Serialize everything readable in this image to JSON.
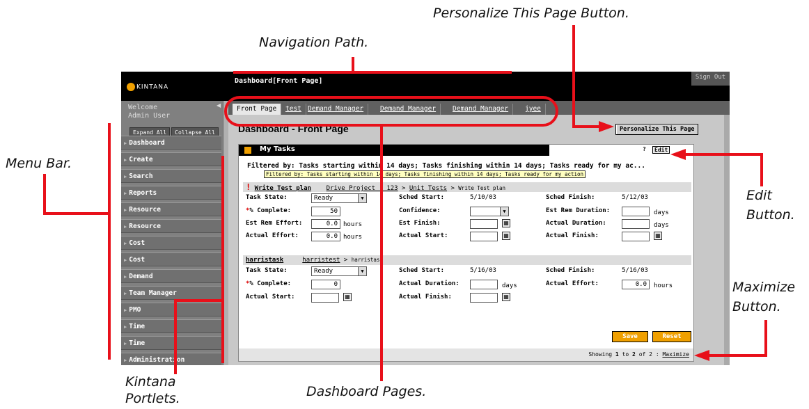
{
  "callouts": {
    "personalize": "Personalize This Page Button.",
    "navigation": "Navigation Path.",
    "menu_bar": "Menu Bar.",
    "edit_1": "Edit",
    "edit_2": "Button.",
    "maximize_1": "Maximize",
    "maximize_2": "Button.",
    "portlets_1": "Kintana",
    "portlets_2": "Portlets.",
    "dashboard_pages": "Dashboard Pages."
  },
  "app": {
    "logo": "KINTANA",
    "nav_path": "Dashboard[Front Page]",
    "sign_out": "Sign Out"
  },
  "sidebar": {
    "welcome_1": "Welcome",
    "welcome_2": "Admin User",
    "expand_all": "Expand All",
    "collapse_all": "Collapse All",
    "items": [
      "Dashboard",
      "Create",
      "Search",
      "Reports",
      "Resource",
      "Resource",
      "Cost",
      "Cost",
      "Demand",
      "Team Manager",
      "PMO",
      "Time",
      "Time",
      "Administration"
    ]
  },
  "tabs": [
    "Front Page",
    "test",
    "Demand Manager",
    "Demand Manager",
    "Demand Manager",
    "jyee"
  ],
  "page": {
    "title": "Dashboard - Front Page",
    "personalize_button": "Personalize This Page"
  },
  "portlet": {
    "title": "My Tasks",
    "help": "?",
    "edit": "Edit",
    "filter": "Filtered by: Tasks starting within 14 days; Tasks finishing within 14 days; Tasks ready for my ac...",
    "tooltip": "Filtered by: Tasks starting within 14 days; Tasks finishing within 14 days; Tasks ready for my action",
    "task1": {
      "bang": "!",
      "name": "Write Test plan",
      "project": "Drive Project - 123",
      "sep1": ">",
      "unit": "Unit Tests",
      "sep2": ">",
      "leaf": "Write Test plan",
      "state_label": "Task State:",
      "state_value": "Ready",
      "sched_start_label": "Sched Start:",
      "sched_start": "5/10/03",
      "sched_finish_label": "Sched Finish:",
      "sched_finish": "5/12/03",
      "pct_label": "% Complete:",
      "pct_value": "50",
      "confidence_label": "Confidence:",
      "est_rem_dur_label": "Est Rem Duration:",
      "days": "days",
      "est_rem_effort_label": "Est Rem Effort:",
      "est_rem_effort": "0.0",
      "hours": "hours",
      "est_finish_label": "Est Finish:",
      "actual_duration_label": "Actual Duration:",
      "actual_effort_label": "Actual Effort:",
      "actual_effort": "0.0",
      "actual_start_label": "Actual Start:",
      "actual_finish_label": "Actual Finish:"
    },
    "task2": {
      "name": "harristask",
      "project": "harristest",
      "sep": ">",
      "leaf": "harristask",
      "state_label": "Task State:",
      "state_value": "Ready",
      "sched_start_label": "Sched Start:",
      "sched_start": "5/16/03",
      "sched_finish_label": "Sched Finish:",
      "sched_finish": "5/16/03",
      "pct_label": "% Complete:",
      "pct_value": "0",
      "actual_duration_label": "Actual Duration:",
      "days": "days",
      "actual_effort_label": "Actual Effort:",
      "actual_effort": "0.0",
      "hours": "hours",
      "actual_start_label": "Actual Start:",
      "actual_finish_label": "Actual Finish:"
    },
    "save": "Save",
    "reset": "Reset",
    "footer_prefix": "Showing",
    "footer_from": "1",
    "footer_to_word": "to",
    "footer_to": "2",
    "footer_of_word": "of",
    "footer_total": "2",
    "footer_colon": ":",
    "maximize": "Maximize"
  },
  "colors": {
    "accent": "#f0a000",
    "callout_line": "#e8101a"
  }
}
